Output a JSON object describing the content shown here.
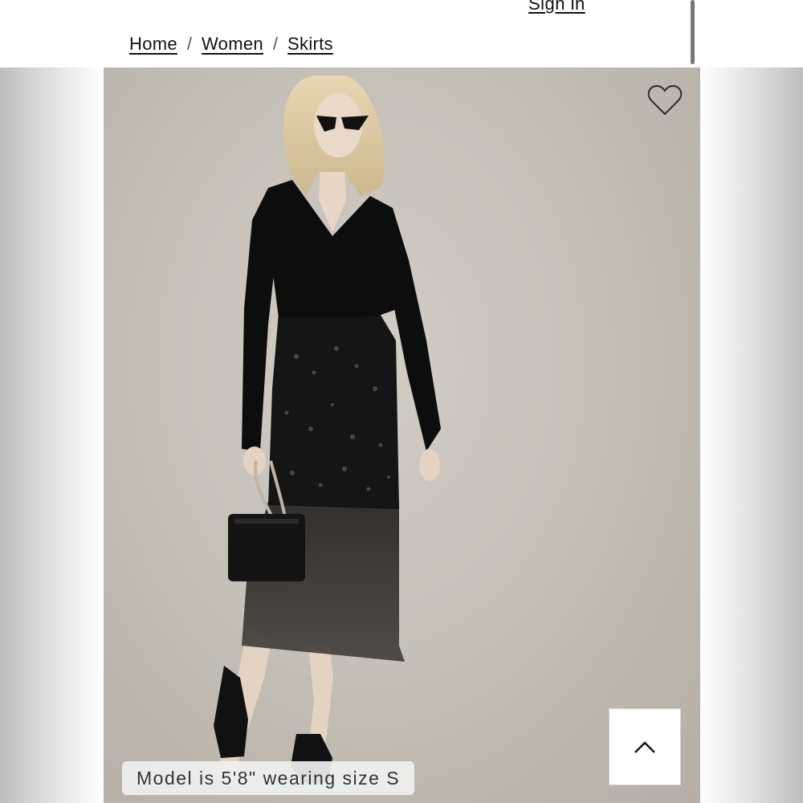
{
  "header": {
    "sign_in_label": "Sign in"
  },
  "breadcrumb": {
    "items": [
      {
        "label": "Home"
      },
      {
        "label": "Women"
      },
      {
        "label": "Skirts"
      }
    ],
    "separator": "/"
  },
  "product_image": {
    "wishlist_icon": "heart-outline-icon",
    "caption": "Model is 5'8\" wearing size S"
  },
  "back_to_top": {
    "icon": "chevron-up-icon"
  }
}
